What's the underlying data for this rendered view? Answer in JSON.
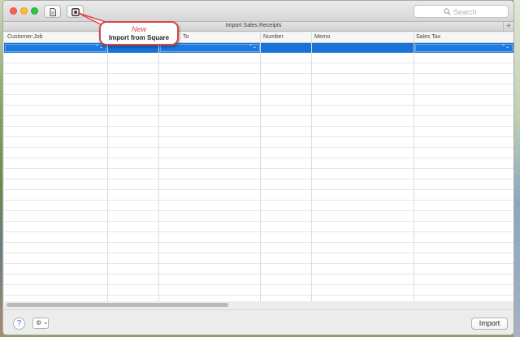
{
  "window": {
    "tab_title": "Import Sales Receipts",
    "new_tab_label": "+"
  },
  "toolbar": {
    "search_placeholder": "Search"
  },
  "callout": {
    "badge": "New",
    "text": "Import from Square"
  },
  "table": {
    "columns": [
      "Customer:Job",
      "",
      "To",
      "Number",
      "Memo",
      "Sales Tax"
    ],
    "selected_row_stepper": "⌃⌄"
  },
  "bottom_bar": {
    "help_label": "?",
    "gear_label": "⚙",
    "gear_chevron": "⌄",
    "import_label": "Import"
  },
  "colors": {
    "selection": "#1873d8",
    "callout_border": "#d9454a"
  },
  "icons": [
    "document-icon",
    "import-square-icon",
    "search-icon",
    "gear-icon",
    "help-icon"
  ]
}
